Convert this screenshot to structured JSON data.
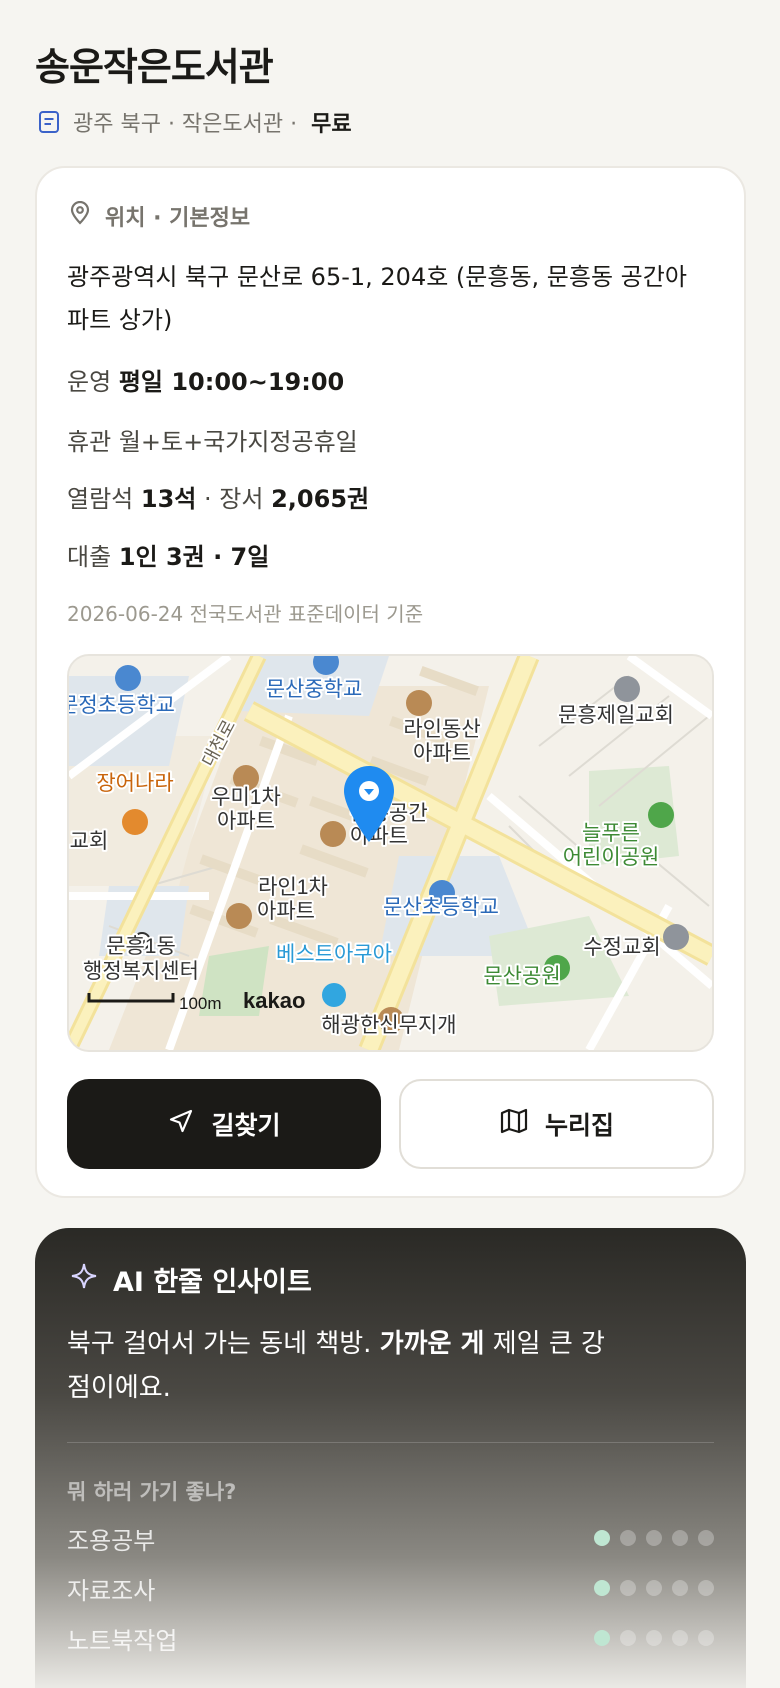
{
  "header": {
    "title": "송운작은도서관",
    "meta": "광주 북구 · 작은도서관 ·",
    "fee": "무료",
    "icon": "document-icon"
  },
  "info": {
    "section_label": "위치 · 기본정보",
    "address": "광주광역시 북구 문산로 65-1, 204호 (문흥동, 문흥동 공간아파트 상가)",
    "hours_label": "운영",
    "hours_value": "평일 10:00~19:00",
    "closed_label": "휴관",
    "closed_value": "월+토+국가지정공휴일",
    "seats_label": "열람석",
    "seats_value": "13석",
    "books_label": "장서",
    "books_value": "2,065권",
    "loan_label": "대출",
    "loan_value": "1인 3권 · 7일",
    "basis": "2026-06-24 전국도서관 표준데이터 기준"
  },
  "map": {
    "labels": {
      "munsan_middle": "문산중학교",
      "munjeong_elem": "문정초등학교",
      "raindong": "라인동산",
      "raindong2": "아파트",
      "munheung_church": "문흥제일교회",
      "road": "대천로",
      "jangeonara": "장어나라",
      "umi1": "우미1차",
      "umi2": "아파트",
      "gyohoe": "교회",
      "gonggan1": "문흥공간",
      "gonggan2": "아파트",
      "neulpureun1": "늘푸른",
      "neulpureun2": "어린이공원",
      "rain1cha1": "라인1차",
      "rain1cha2": "아파트",
      "munsan_elem": "문산초등학교",
      "sujeong": "수정교회",
      "munheung1_1": "문흥1동",
      "munheung1_2": "행정복지센터",
      "best_aqua": "베스트아쿠아",
      "munsan_park": "문산공원",
      "haegwang": "해광한신무지개",
      "scale": "100m",
      "brand": "kakao"
    },
    "colors": {
      "road_main": "#fbeeaa",
      "block": "#efe6d6",
      "school": "#dde6ee",
      "park": "#dde9d4",
      "pin": "#1f8bf0"
    }
  },
  "actions": {
    "directions": "길찾기",
    "directions_icon": "navigation-arrow-icon",
    "nurijip": "누리집",
    "nurijip_icon": "map-icon"
  },
  "ai": {
    "title": "AI 한줄 인사이트",
    "icon": "sparkle-icon",
    "text_pre": "북구 걸어서 가는 동네 책방. ",
    "text_bold": "가까운 게",
    "text_post": " 제일 큰 강점이에요.",
    "question": "뭐 하러 가기 좋나?",
    "activities": [
      {
        "label": "조용공부",
        "rating": 1,
        "max": 5
      },
      {
        "label": "자료조사",
        "rating": 1,
        "max": 5
      },
      {
        "label": "노트북작업",
        "rating": 1,
        "max": 5
      }
    ],
    "accent_color": "#bfe6d2"
  }
}
